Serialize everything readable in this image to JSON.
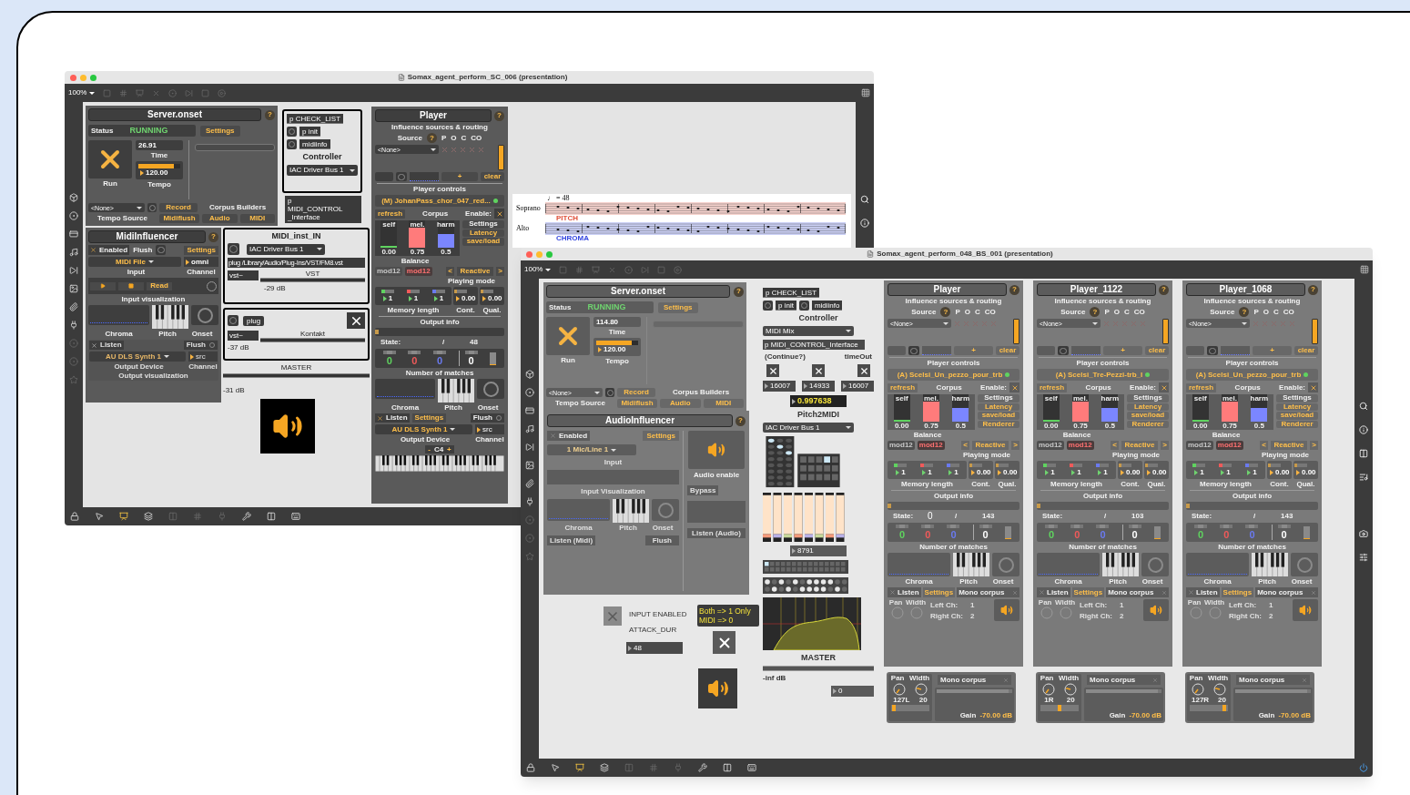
{
  "back_window": {
    "title": "Somax_agent_perform_SC_006 (presentation)",
    "zoom": "100%",
    "server": {
      "title": "Server.onset",
      "help": "?",
      "status_label": "Status",
      "status": "RUNNING",
      "settings": "Settings",
      "time": "26.91",
      "time_label": "Time",
      "tempo": {
        "value": "120.00",
        "level": 0.85,
        "label": "Tempo"
      },
      "run_label": "Run",
      "running": true,
      "tempo_source": "<None>",
      "tempo_source_label": "Tempo Source",
      "record": "Record",
      "corpus_builders": "Corpus Builders",
      "midiflush": "Midiflush",
      "audio": "Audio",
      "midi": "MIDI"
    },
    "controller": {
      "objects": [
        "p CHECK_LIST",
        "p init",
        "midiinfo"
      ],
      "title": "Controller",
      "device": "IAC Driver Bus 1"
    },
    "midi_control": [
      "p",
      "MIDI_CONTROL",
      "_Interface"
    ],
    "midi_influencer": {
      "title": "MidiInfluencer",
      "help": "?",
      "enabled_label": "Enabled",
      "enabled": true,
      "flush": "Flush",
      "settings": "Settings",
      "input": "MIDI File",
      "input_label": "Input",
      "channel": "omni",
      "channel_label": "Channel",
      "read": "Read",
      "input_vis_label": "Input visualization",
      "chroma": "Chroma",
      "pitch": "Pitch",
      "onset": "Onset",
      "listen": "Listen",
      "listen_checked": false,
      "flush2": "Flush",
      "output": "AU DLS Synth 1",
      "output_channel": "src",
      "output_label": "Output Device",
      "output_channel_label": "Channel",
      "output_vis_label": "Output visualization",
      "output_disabled": true
    },
    "midi_inst": {
      "title": "MIDI_inst_IN",
      "device": "IAC Driver Bus 1",
      "plugin": "plug /Library/Audio/Plug-Ins/VST/FM8.vst",
      "object": "vst~",
      "meter_label": "VST",
      "reading": "-29 dB"
    },
    "kontakt": {
      "object": "plug",
      "vst": "vst~",
      "meter_label": "Kontakt",
      "reading": "-37 dB",
      "toggle": true
    },
    "master": {
      "label": "MASTER",
      "reading": "-31 dB"
    },
    "score": {
      "tempo": "♩ = 48",
      "staves": [
        {
          "name": "Soprano",
          "tag": "PITCH",
          "color": "#e0503a"
        },
        {
          "name": "Alto",
          "tag": "CHROMA",
          "color": "#3346e0"
        }
      ]
    },
    "player": {
      "kind": "midi",
      "title": "Player",
      "help": "?",
      "routing_label": "Influence sources & routing",
      "source_label": "Source",
      "source_help": "?",
      "source_cols": [
        "P",
        "O",
        "C",
        "CO"
      ],
      "source_value": "<None>",
      "add": "+",
      "clear": "clear",
      "controls_label": "Player controls",
      "corpus": "(M) JohanPass_chor_047_red...",
      "refresh": "refresh",
      "corpus_label": "Corpus",
      "enable_label": "Enable:",
      "enabled": true,
      "balance": [
        {
          "label": "self",
          "level": 0,
          "value": "0.00",
          "color": "#5fd35f"
        },
        {
          "label": "mel.",
          "level": 0.75,
          "value": "0.75",
          "color": "#ff7b7b"
        },
        {
          "label": "harm",
          "level": 0.5,
          "value": "0.5",
          "color": "#7b86ff"
        }
      ],
      "balance_label": "Balance",
      "side_buttons": [
        "Settings",
        "Latency",
        "save/load"
      ],
      "mod_buttons": [
        {
          "label": "mod12",
          "on": false
        },
        {
          "label": "mod12",
          "on": true
        }
      ],
      "prev": "<",
      "mode": "Reactive",
      "next": ">",
      "mode_label": "Playing mode",
      "memory": [
        {
          "value": "1",
          "color": "#5fd35f"
        },
        {
          "value": "1",
          "color": "#f05a5a"
        },
        {
          "value": "1",
          "color": "#6a7af0"
        }
      ],
      "memory_label": "Memory length",
      "cont": "0.00",
      "cont_label": "Cont.",
      "qual": "0.00",
      "qual_label": "Qual.",
      "output_label": "Output info",
      "state_label": "State:",
      "slash": "/",
      "state_total": "48",
      "progress": {
        "level": 0.03
      },
      "matches": [
        {
          "value": "0",
          "color": "#5fd35f"
        },
        {
          "value": "0",
          "color": "#f05a5a"
        },
        {
          "value": "0",
          "color": "#6a7af0"
        },
        {
          "value": "0",
          "color": "#ffffff"
        }
      ],
      "matches_label": "Number of matches",
      "chroma": "Chroma",
      "pitch": "Pitch",
      "onset": "Onset",
      "footer": {
        "listen": "Listen",
        "listen_checked": true,
        "settings": "Settings",
        "flush": "Flush",
        "output": "AU DLS Synth 1",
        "channel": "src",
        "output_label": "Output Device",
        "channel_label": "Channel",
        "minus": "-",
        "octave": "C4",
        "plus": "+"
      }
    }
  },
  "front_window": {
    "title": "Somax_agent_perform_048_BS_001 (presentation)",
    "zoom": "100%",
    "server": {
      "title": "Server.onset",
      "help": "?",
      "status_label": "Status",
      "status": "RUNNING",
      "settings": "Settings",
      "time": "114.80",
      "time_label": "Time",
      "tempo": {
        "value": "120.00",
        "level": 0.85,
        "label": "Tempo"
      },
      "run_label": "Run",
      "running": true,
      "tempo_source": "<None>",
      "tempo_source_label": "Tempo Source",
      "record": "Record",
      "corpus_builders": "Corpus Builders",
      "midiflush": "Midiflush",
      "audio": "Audio",
      "midi": "MIDI"
    },
    "controller": {
      "objects": [
        "p CHECK_LIST",
        "p init",
        "midiinfo"
      ],
      "title": "Controller",
      "device": "MIDI Mix"
    },
    "midi_control": [
      "p MIDI_CONTROL_Interface"
    ],
    "watchdog": {
      "labels": [
        "(Continue?)",
        "timeOut"
      ],
      "toggles": [
        true,
        true,
        true
      ],
      "numbers": [
        "16007",
        "14933",
        "16007"
      ],
      "score": "0.997638"
    },
    "pitch2midi": {
      "title": "Pitch2MIDI",
      "device": "IAC Driver Bus 1",
      "counter": "8791"
    },
    "master": {
      "label": "MASTER",
      "reading": "-inf dB",
      "number": "0"
    },
    "audio_influencer": {
      "title": "AudioInfluencer",
      "help": "?",
      "enabled_label": "Enabled",
      "enabled": false,
      "settings": "Settings",
      "input": "1 Mic/Line 1",
      "input_label": "Input",
      "input_vis_label": "Input Visualization",
      "audio_enable": "Audio enable",
      "bypass": "Bypass",
      "chroma": "Chroma",
      "pitch": "Pitch",
      "onset": "Onset",
      "listen_midi": "Listen (Midi)",
      "flush": "Flush",
      "listen_audio": "Listen (Audio)"
    },
    "input_enabled": {
      "checked": false,
      "label": "INPUT ENABLED"
    },
    "attack_label": "ATTACK_DUR",
    "attack": "48",
    "mode_note": [
      "Both => 1 Only",
      "MIDI => 0"
    ],
    "mode_toggle": true,
    "players": [
      {
        "kind": "audio",
        "title": "Player",
        "help": "?",
        "routing_label": "Influence sources & routing",
        "source_label": "Source",
        "source_help": "?",
        "source_cols": [
          "P",
          "O",
          "C",
          "CO"
        ],
        "source_value": "<None>",
        "add": "+",
        "clear": "clear",
        "controls_label": "Player controls",
        "corpus": "(A) Scelsi_Un_pezzo_pour_trb",
        "refresh": "refresh",
        "corpus_label": "Corpus",
        "enable_label": "Enable:",
        "enabled": true,
        "balance": [
          {
            "label": "self",
            "level": 0,
            "value": "0.00",
            "color": "#5fd35f"
          },
          {
            "label": "mel.",
            "level": 0.75,
            "value": "0.75",
            "color": "#ff7b7b"
          },
          {
            "label": "harm",
            "level": 0.5,
            "value": "0.5",
            "color": "#7b86ff"
          }
        ],
        "balance_label": "Balance",
        "side_buttons": [
          "Settings",
          "Latency",
          "save/load",
          "Renderer"
        ],
        "mod_buttons": [
          {
            "label": "mod12",
            "on": false
          },
          {
            "label": "mod12",
            "on": true
          }
        ],
        "prev": "<",
        "mode": "Reactive",
        "next": ">",
        "mode_label": "Playing mode",
        "memory": [
          {
            "value": "1",
            "color": "#5fd35f"
          },
          {
            "value": "1",
            "color": "#f05a5a"
          },
          {
            "value": "1",
            "color": "#6a7af0"
          }
        ],
        "memory_label": "Memory length",
        "cont": "0.00",
        "cont_label": "Cont.",
        "qual": "0.00",
        "qual_label": "Qual.",
        "output_label": "Output info",
        "state_label": "State:",
        "state_value": "0",
        "slash": "/",
        "state_total": "143",
        "progress": {
          "level": 0.03
        },
        "matches": [
          {
            "value": "0",
            "color": "#5fd35f"
          },
          {
            "value": "0",
            "color": "#f05a5a"
          },
          {
            "value": "0",
            "color": "#6a7af0"
          },
          {
            "value": "0",
            "color": "#ffffff"
          }
        ],
        "matches_label": "Number of matches",
        "chroma": "Chroma",
        "pitch": "Pitch",
        "onset": "Onset",
        "footer": {
          "listen": "Listen",
          "listen_checked": false,
          "settings": "Settings",
          "mono": "Mono corpus",
          "mono_checked": false,
          "pan": "Pan",
          "width": "Width",
          "left": "Left Ch:",
          "left_value": "1",
          "right": "Right Ch:",
          "right_value": "2"
        },
        "output": {
          "pan": "Pan",
          "width": "Width",
          "pan_value": "127L",
          "width_value": "20",
          "level": 0.02,
          "mono": "Mono corpus",
          "mono_checked": false,
          "gain": "Gain",
          "gain_value": "-70.00 dB"
        }
      },
      {
        "kind": "audio",
        "title": "Player_1122",
        "help": "?",
        "routing_label": "Influence sources & routing",
        "source_label": "Source",
        "source_help": "?",
        "source_cols": [
          "P",
          "O",
          "C",
          "CO"
        ],
        "source_value": "<None>",
        "add": "+",
        "clear": "clear",
        "controls_label": "Player controls",
        "corpus": "(A) Scelsi_Tre-Pezzi-trb_I",
        "refresh": "refresh",
        "corpus_label": "Corpus",
        "enable_label": "Enable:",
        "enabled": true,
        "balance": [
          {
            "label": "self",
            "level": 0,
            "value": "0.00",
            "color": "#5fd35f"
          },
          {
            "label": "mel.",
            "level": 0.75,
            "value": "0.75",
            "color": "#ff7b7b"
          },
          {
            "label": "harm",
            "level": 0.5,
            "value": "0.5",
            "color": "#7b86ff"
          }
        ],
        "balance_label": "Balance",
        "side_buttons": [
          "Settings",
          "Latency",
          "save/load",
          "Renderer"
        ],
        "mod_buttons": [
          {
            "label": "mod12",
            "on": false
          },
          {
            "label": "mod12",
            "on": true
          }
        ],
        "prev": "<",
        "mode": "Reactive",
        "next": ">",
        "mode_label": "Playing mode",
        "memory": [
          {
            "value": "1",
            "color": "#5fd35f"
          },
          {
            "value": "1",
            "color": "#f05a5a"
          },
          {
            "value": "1",
            "color": "#6a7af0"
          }
        ],
        "memory_label": "Memory length",
        "cont": "0.00",
        "cont_label": "Cont.",
        "qual": "0.00",
        "qual_label": "Qual.",
        "output_label": "Output info",
        "state_label": "State:",
        "slash": "/",
        "state_total": "103",
        "progress": {
          "level": 0.03
        },
        "matches": [
          {
            "value": "0",
            "color": "#5fd35f"
          },
          {
            "value": "0",
            "color": "#f05a5a"
          },
          {
            "value": "0",
            "color": "#6a7af0"
          },
          {
            "value": "0",
            "color": "#ffffff"
          }
        ],
        "matches_label": "Number of matches",
        "chroma": "Chroma",
        "pitch": "Pitch",
        "onset": "Onset",
        "footer": {
          "listen": "Listen",
          "listen_checked": false,
          "settings": "Settings",
          "mono": "Mono corpus",
          "mono_checked": false,
          "pan": "Pan",
          "width": "Width",
          "left": "Left Ch:",
          "left_value": "1",
          "right": "Right Ch:",
          "right_value": "2"
        },
        "output": {
          "pan": "Pan",
          "width": "Width",
          "pan_value": "1R",
          "width_value": "20",
          "level": 0.5,
          "mono": "Mono corpus",
          "mono_checked": false,
          "gain": "Gain",
          "gain_value": "-70.00 dB"
        }
      },
      {
        "kind": "audio",
        "title": "Player_1068",
        "help": "?",
        "routing_label": "Influence sources & routing",
        "source_label": "Source",
        "source_help": "?",
        "source_cols": [
          "P",
          "O",
          "C",
          "CO"
        ],
        "source_value": "<None>",
        "add": "+",
        "clear": "clear",
        "controls_label": "Player controls",
        "corpus": "(A) Scelsi_Un_pezzo_pour_trb",
        "refresh": "refresh",
        "corpus_label": "Corpus",
        "enable_label": "Enable:",
        "enabled": true,
        "balance": [
          {
            "label": "self",
            "level": 0,
            "value": "0.00",
            "color": "#5fd35f"
          },
          {
            "label": "mel.",
            "level": 0.75,
            "value": "0.75",
            "color": "#ff7b7b"
          },
          {
            "label": "harm",
            "level": 0.5,
            "value": "0.5",
            "color": "#7b86ff"
          }
        ],
        "balance_label": "Balance",
        "side_buttons": [
          "Settings",
          "Latency",
          "save/load",
          "Renderer"
        ],
        "mod_buttons": [
          {
            "label": "mod12",
            "on": false
          },
          {
            "label": "mod12",
            "on": true
          }
        ],
        "prev": "<",
        "mode": "Reactive",
        "next": ">",
        "mode_label": "Playing mode",
        "memory": [
          {
            "value": "1",
            "color": "#5fd35f"
          },
          {
            "value": "1",
            "color": "#f05a5a"
          },
          {
            "value": "1",
            "color": "#6a7af0"
          }
        ],
        "memory_label": "Memory length",
        "cont": "0.00",
        "cont_label": "Cont.",
        "qual": "0.00",
        "qual_label": "Qual.",
        "output_label": "Output info",
        "state_label": "State:",
        "slash": "/",
        "state_total": "143",
        "progress": {
          "level": 0.03
        },
        "matches": [
          {
            "value": "0",
            "color": "#5fd35f"
          },
          {
            "value": "0",
            "color": "#f05a5a"
          },
          {
            "value": "0",
            "color": "#6a7af0"
          },
          {
            "value": "0",
            "color": "#ffffff"
          }
        ],
        "matches_label": "Number of matches",
        "chroma": "Chroma",
        "pitch": "Pitch",
        "onset": "Onset",
        "footer": {
          "listen": "Listen",
          "listen_checked": false,
          "settings": "Settings",
          "mono": "Mono corpus",
          "mono_checked": false,
          "pan": "Pan",
          "width": "Width",
          "left": "Left Ch:",
          "left_value": "1",
          "right": "Right Ch:",
          "right_value": "2"
        },
        "output": {
          "pan": "Pan",
          "width": "Width",
          "pan_value": "127R",
          "width_value": "20",
          "level": 0.95,
          "mono": "Mono corpus",
          "mono_checked": false,
          "gain": "Gain",
          "gain_value": "-70.00 dB"
        }
      }
    ]
  }
}
